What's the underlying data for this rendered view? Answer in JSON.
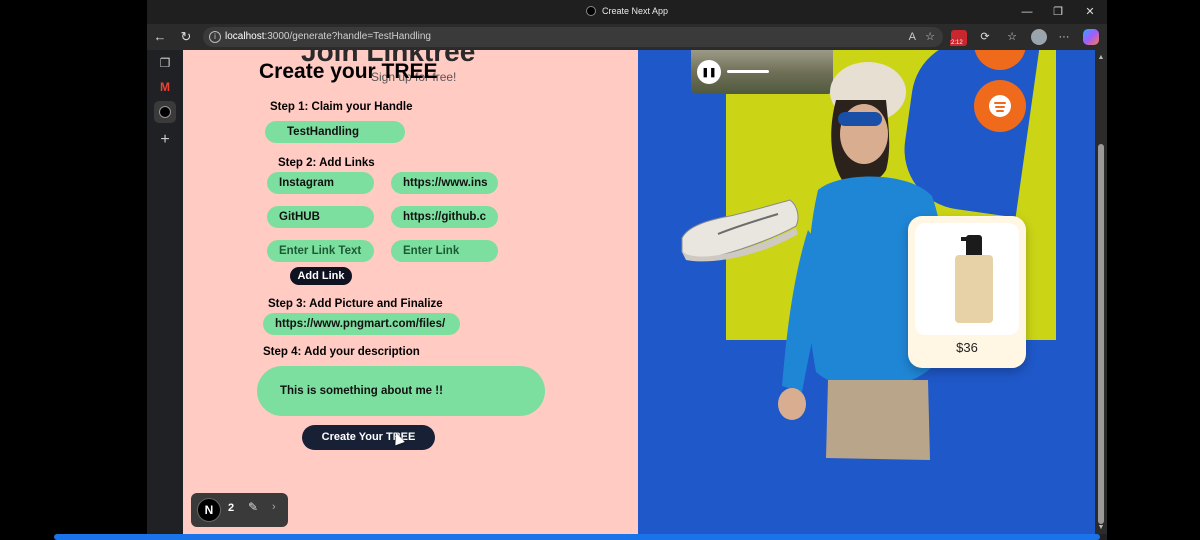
{
  "window": {
    "title": "Create Next App"
  },
  "url": {
    "host": "localhost",
    "rest": ":3000/generate?handle=TestHandling"
  },
  "form": {
    "ghost_title": "Join Linktree",
    "ghost_subtitle": "Sign up for free!",
    "heading": "Create your TREE",
    "step1_label": "Step 1: Claim your Handle",
    "handle_value": "TestHandling",
    "step2_label": "Step 2: Add Links",
    "links": [
      {
        "text": "Instagram",
        "url": "https://www.ins"
      },
      {
        "text": "GitHUB",
        "url": "https://github.c"
      }
    ],
    "link_text_placeholder": "Enter Link Text",
    "link_url_placeholder": "Enter Link",
    "add_link_label": "Add Link",
    "step3_label": "Step 3: Add Picture and Finalize",
    "picture_value": "https://www.pngmart.com/files/",
    "step4_label": "Step 4: Add your description",
    "description_value": "This is something about me !!",
    "create_label": "Create Your TREE"
  },
  "devtools": {
    "logo": "N",
    "issue_count": "2"
  },
  "promo": {
    "price": "$36"
  },
  "colors": {
    "left_bg": "#ffcbc3",
    "pill_green": "#7ddf9f",
    "right_bg": "#1f58c9",
    "yellow": "#cbd516",
    "orange": "#f06a1c"
  }
}
